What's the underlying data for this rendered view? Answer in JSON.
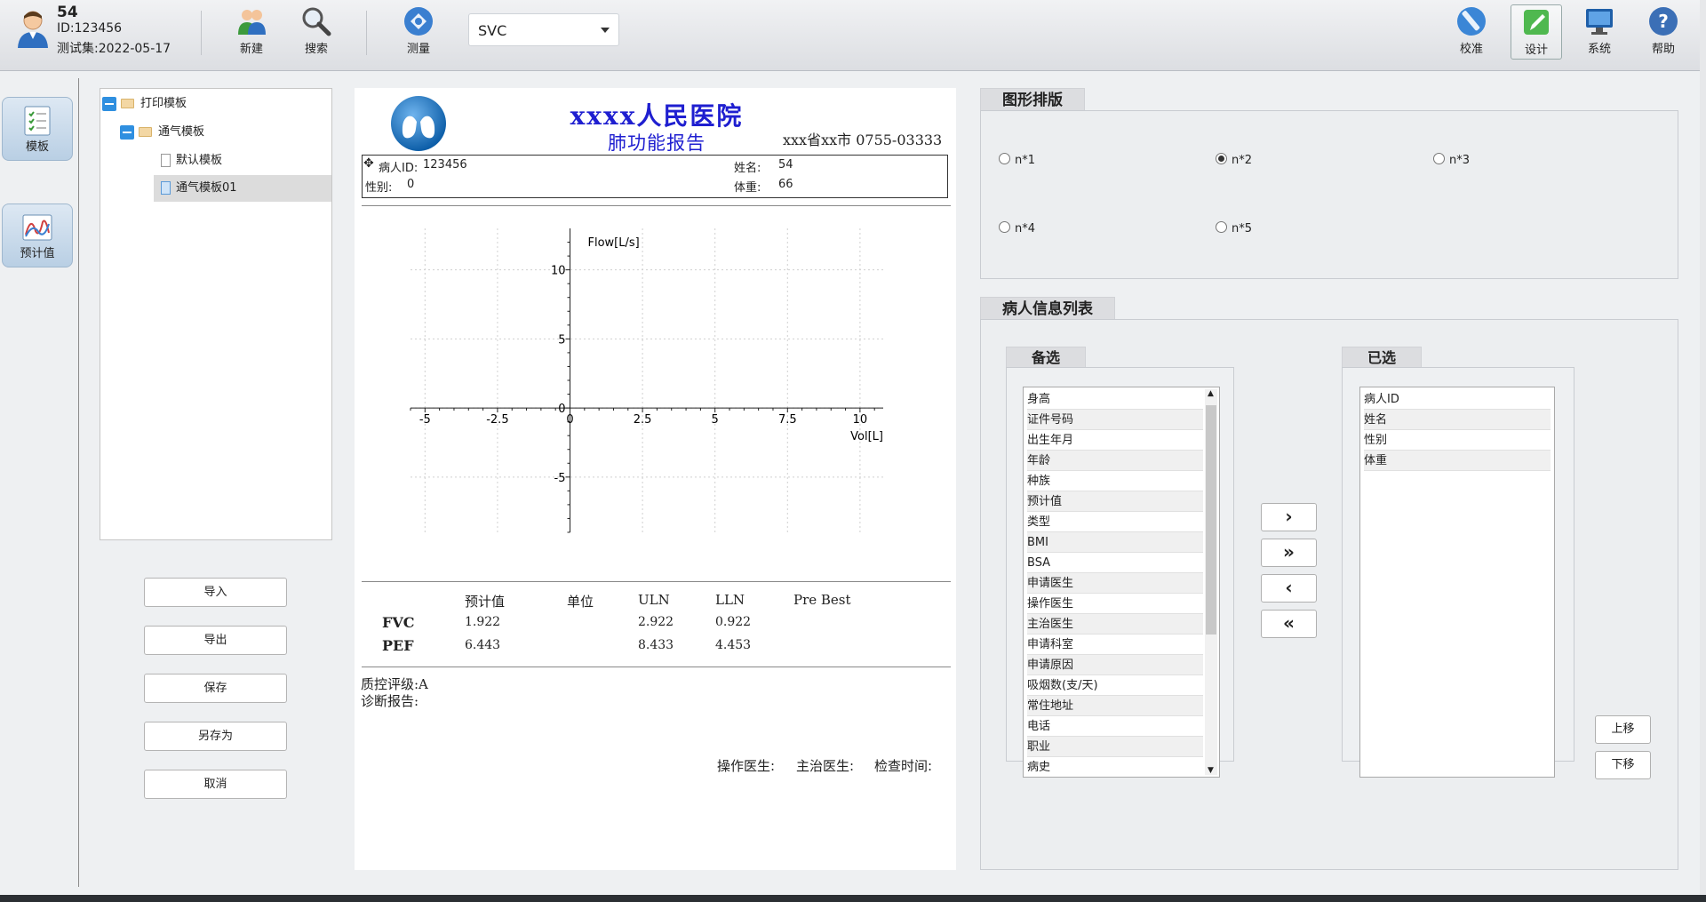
{
  "user": {
    "name": "54",
    "id": "ID:123456",
    "date": "测试集:2022-05-17"
  },
  "toolbar": {
    "new": "新建",
    "search": "搜索",
    "measure": "测量",
    "mode_value": "SVC",
    "calibrate": "校准",
    "design": "设计",
    "system": "系统",
    "help": "帮助"
  },
  "sidebar": {
    "template": "模板",
    "predicted": "预计值"
  },
  "tree": {
    "root": "打印模板",
    "group": "通气模板",
    "item1": "默认模板",
    "item2": "通气模板01"
  },
  "buttons": {
    "import": "导入",
    "export": "导出",
    "save": "保存",
    "save_as": "另存为",
    "cancel": "取消"
  },
  "report": {
    "hospital": "xxxx人民医院",
    "subtitle": "肺功能报告",
    "contact": "xxx省xx市 0755-03333",
    "patient_id_label": "病人ID:",
    "patient_id": "123456",
    "name_label": "姓名:",
    "name": "54",
    "gender_label": "性别:",
    "gender": "0",
    "weight_label": "体重:",
    "weight": "66",
    "table_headers": [
      "预计值",
      "单位",
      "ULN",
      "LLN",
      "Pre Best"
    ],
    "rows": [
      {
        "name": "FVC",
        "pred": "1.922",
        "unit": "",
        "uln": "2.922",
        "lln": "0.922",
        "best": ""
      },
      {
        "name": "PEF",
        "pred": "6.443",
        "unit": "",
        "uln": "8.433",
        "lln": "4.453",
        "best": ""
      }
    ],
    "qc": "质控评级:A",
    "diagnosis": "诊断报告:",
    "operator": "操作医生:",
    "attending": "主治医生:",
    "exam_time": "检查时间:"
  },
  "chart_data": {
    "type": "line",
    "title": "",
    "xlabel": "Vol[L]",
    "ylabel": "Flow[L/s]",
    "xlim": [
      -5.5,
      10.8
    ],
    "ylim": [
      -9,
      13
    ],
    "xticks": [
      -5,
      -2.5,
      0,
      2.5,
      5,
      7.5,
      10
    ],
    "xtick_labels": [
      "-5",
      "-2.5",
      "0",
      "2.5",
      "5",
      "7.5",
      "10"
    ],
    "yticks": [
      -5,
      0,
      5,
      10
    ],
    "ytick_labels": [
      "-5",
      "0",
      "5",
      "10"
    ],
    "grid": true,
    "series": []
  },
  "layout_panel": {
    "title": "图形排版",
    "options": [
      "n*1",
      "n*2",
      "n*3",
      "n*4",
      "n*5"
    ],
    "selected": "n*2"
  },
  "patient_info": {
    "title": "病人信息列表",
    "available_title": "备选",
    "selected_title": "已选",
    "available": [
      "身高",
      "证件号码",
      "出生年月",
      "年龄",
      "种族",
      "预计值",
      "类型",
      "BMI",
      "BSA",
      "申请医生",
      "操作医生",
      "主治医生",
      "申请科室",
      "申请原因",
      "吸烟数(支/天)",
      "常住地址",
      "电话",
      "职业",
      "病史"
    ],
    "selected": [
      "病人ID",
      "姓名",
      "性别",
      "体重"
    ],
    "move_up": "上移",
    "move_down": "下移",
    "add_one": "›",
    "add_all": "»",
    "remove_one": "‹",
    "remove_all": "«"
  }
}
